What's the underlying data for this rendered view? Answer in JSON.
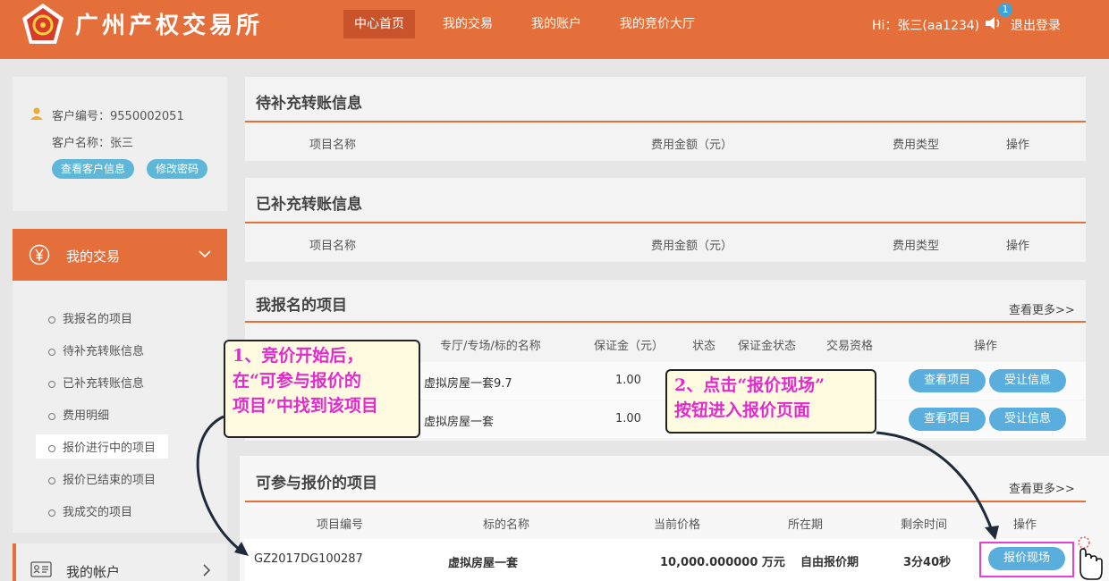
{
  "header": {
    "logo_text": "广州产权交易所",
    "nav": [
      "中心首页",
      "我的交易",
      "我的账户",
      "我的竞价大厅"
    ],
    "greeting": "Hi：张三(aa1234)",
    "notification_count": "1",
    "logout": "退出登录"
  },
  "user": {
    "customer_no": "客户编号：9550002051",
    "customer_name": "客户名称：张三",
    "view_info": "查看客户信息",
    "change_password": "修改密码"
  },
  "sidebar": {
    "section_title": "我的交易",
    "items": [
      "我报名的项目",
      "待补充转账信息",
      "已补充转账信息",
      "费用明细",
      "报价进行中的项目",
      "报价已结束的项目",
      "我成交的项目"
    ],
    "selected_index": 4,
    "account_title": "我的帐户"
  },
  "pending_transfer": {
    "title": "待补充转账信息",
    "columns": [
      "项目名称",
      "费用金额（元）",
      "费用类型",
      "操作"
    ]
  },
  "done_transfer": {
    "title": "已补充转账信息",
    "columns": [
      "项目名称",
      "费用金额（元）",
      "费用类型",
      "操作"
    ]
  },
  "registered": {
    "title": "我报名的项目",
    "more": "查看更多>>",
    "columns": [
      "专厅/专场/标的名称",
      "保证金（元）",
      "状态",
      "保证金状态",
      "交易资格",
      "操作"
    ],
    "rows": [
      {
        "name": "虚拟房屋一套9.7",
        "deposit": "1.00",
        "btn1": "查看项目",
        "btn2": "受让信息"
      },
      {
        "name": "虚拟房屋一套",
        "deposit": "1.00",
        "btn1": "查看项目",
        "btn2": "受让信息"
      }
    ]
  },
  "biddable": {
    "title": "可参与报价的项目",
    "more": "查看更多>>",
    "columns": [
      "项目编号",
      "标的名称",
      "当前价格",
      "所在期",
      "剩余时间",
      "操作"
    ],
    "row": {
      "code": "GZ2017DG100287",
      "name": "虚拟房屋一套",
      "price": "10,000.000000 万元",
      "period": "自由报价期",
      "remaining": "3分40秒",
      "action": "报价现场"
    }
  },
  "callouts": {
    "step1": [
      "1、竞价开始后，",
      "在“可参与报价的",
      "项目”中找到该项目"
    ],
    "step2": [
      "2、点击“报价现场”",
      "按钮进入报价页面"
    ]
  },
  "colors": {
    "brand": "#e56f3b",
    "button": "#5aaede",
    "highlight": "#e83fd6"
  }
}
